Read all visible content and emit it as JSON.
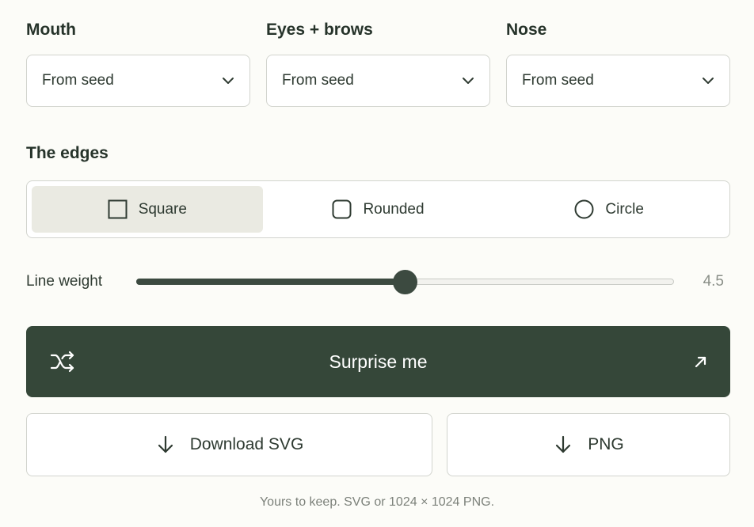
{
  "features": [
    {
      "label": "Mouth",
      "value": "From seed"
    },
    {
      "label": "Eyes + brows",
      "value": "From seed"
    },
    {
      "label": "Nose",
      "value": "From seed"
    }
  ],
  "edges": {
    "label": "The edges",
    "selected": "Square",
    "options": [
      {
        "label": "Square",
        "icon": "square-icon"
      },
      {
        "label": "Rounded",
        "icon": "rounded-square-icon"
      },
      {
        "label": "Circle",
        "icon": "circle-icon"
      }
    ]
  },
  "line_weight": {
    "label": "Line weight",
    "value_text": "4.5",
    "fill_fraction": 0.5
  },
  "surprise": {
    "label": "Surprise me"
  },
  "download": {
    "svg_label": "Download SVG",
    "png_label": "PNG"
  },
  "footnote": "Yours to keep. SVG or 1024 × 1024 PNG.",
  "colors": {
    "accent": "#354739",
    "background": "#fcfcf8",
    "active_segment": "#eaeae2",
    "border": "#d2d4ce"
  }
}
